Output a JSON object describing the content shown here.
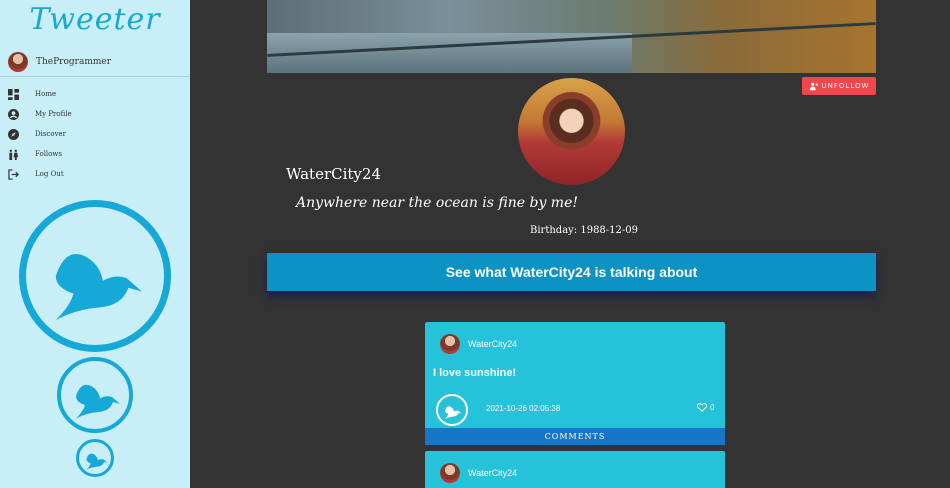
{
  "app": {
    "brand": "Tweeter"
  },
  "sidebar": {
    "user": {
      "name": "TheProgrammer"
    },
    "items": [
      {
        "label": "Home",
        "icon": "dashboard-icon"
      },
      {
        "label": "My Profile",
        "icon": "user-circle-icon"
      },
      {
        "label": "Discover",
        "icon": "compass-icon"
      },
      {
        "label": "Follows",
        "icon": "people-icon"
      },
      {
        "label": "Log Out",
        "icon": "logout-icon"
      }
    ]
  },
  "profile": {
    "unfollow_label": "UNFOLLOW",
    "name": "WaterCity24",
    "bio": "Anywhere near the ocean is fine by me!",
    "birthday": "Birthday: 1988-12-09",
    "talk_banner": "See what WaterCity24 is talking about"
  },
  "posts": [
    {
      "author": "WaterCity24",
      "text": "I love sunshine!",
      "timestamp": "2021-10-26 02:05:38",
      "likes": "0",
      "comments_label": "COMMENTS"
    },
    {
      "author": "WaterCity24"
    }
  ],
  "colors": {
    "sidebar_bg": "#c8eef7",
    "accent": "#16a9d8",
    "main_bg": "#333333",
    "post_bg": "#25c2d9",
    "comments_bg": "#1876c6",
    "unfollow_bg": "#f0474d",
    "banner_bg": "#0c93c4"
  }
}
